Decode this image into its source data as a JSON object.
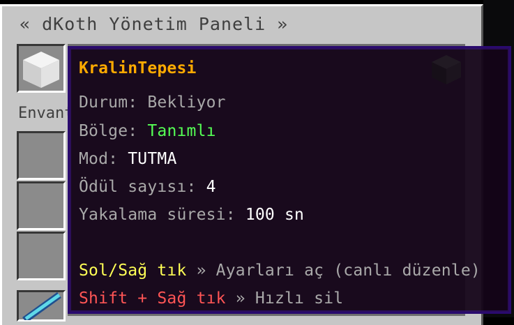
{
  "panel": {
    "title": "« dKoth Yönetim Paneli »",
    "inventory_label": "Envanter"
  },
  "tooltip": {
    "name": "KralinTepesi",
    "status_label": "Durum: ",
    "status_value": "Bekliyor",
    "region_label": "Bölge: ",
    "region_value": "Tanımlı",
    "mode_label": "Mod: ",
    "mode_value": "TUTMA",
    "reward_label": "Ödül sayısı: ",
    "reward_value": "4",
    "capture_label": "Yakalama süresi: ",
    "capture_value": "100 sn",
    "left_action_key": "Sol/Sağ tık",
    "left_action_desc": " » Ayarları aç (canlı düzenle)",
    "shift_action_key": "Shift + Sağ tık",
    "shift_action_desc": " » Hızlı sil"
  },
  "colors": {
    "name": "#ffaa00",
    "label": "#a9a9a9",
    "value": "#ffffff",
    "defined": "#55ff55",
    "left_action": "#ffff55",
    "shift_action": "#ff5555"
  },
  "icons": [
    "white-wool-block-icon",
    "diamond-sword-icon",
    "dark-block-icon"
  ]
}
